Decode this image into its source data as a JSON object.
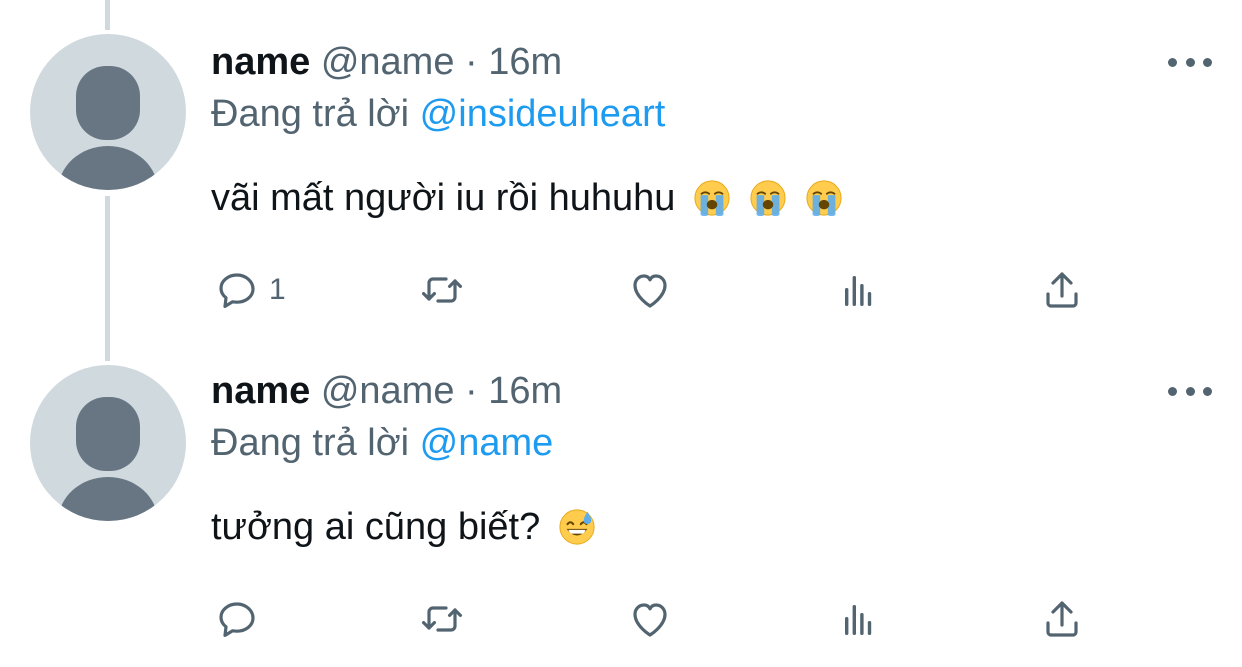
{
  "tweets": [
    {
      "display_name": "name",
      "handle": "@name",
      "separator": "·",
      "time": "16m",
      "reply_prefix": "Đang trả lời",
      "reply_mention": "@insideuheart",
      "text": "vãi mất người iu rồi huhuhu",
      "emojis": [
        "loudly-crying-face",
        "loudly-crying-face",
        "loudly-crying-face"
      ],
      "reply_count": "1"
    },
    {
      "display_name": "name",
      "handle": "@name",
      "separator": "·",
      "time": "16m",
      "reply_prefix": "Đang trả lời",
      "reply_mention": "@name",
      "text": "tưởng ai cũng biết?",
      "emojis": [
        "grinning-face-with-sweat"
      ],
      "reply_count": ""
    }
  ],
  "icons": {
    "reply": "reply-icon",
    "retweet": "retweet-icon",
    "like": "heart-icon",
    "analytics": "analytics-icon",
    "share": "share-icon",
    "more": "more-icon"
  },
  "colors": {
    "link": "#1d9bf0",
    "secondary_text": "#536471",
    "thread_line": "#cfd9de"
  }
}
